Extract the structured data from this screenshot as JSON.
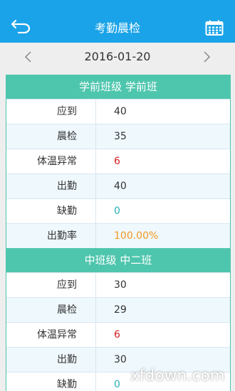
{
  "header": {
    "title": "考勤晨检",
    "back_icon": "back-arrow-icon",
    "calendar_icon": "calendar-icon"
  },
  "datebar": {
    "date": "2016-01-20",
    "prev_icon": "chevron-left-icon",
    "next_icon": "chevron-right-icon"
  },
  "cards": [
    {
      "title": "学前班级 学前班",
      "rows": [
        {
          "label": "应到",
          "value": "40"
        },
        {
          "label": "晨检",
          "value": "35"
        },
        {
          "label": "体温异常",
          "value": "6"
        },
        {
          "label": "出勤",
          "value": "40"
        },
        {
          "label": "缺勤",
          "value": "0"
        },
        {
          "label": "出勤率",
          "value": "100.00%"
        }
      ]
    },
    {
      "title": "中班级 中二班",
      "rows": [
        {
          "label": "应到",
          "value": "30"
        },
        {
          "label": "晨检",
          "value": "29"
        },
        {
          "label": "体温异常",
          "value": "6"
        },
        {
          "label": "出勤",
          "value": "30"
        },
        {
          "label": "缺勤",
          "value": "0"
        }
      ]
    }
  ],
  "colors": {
    "header": "#1aa3e8",
    "card_accent": "#4ec6ad",
    "abnormal": "#d32020",
    "absent": "#2ab0b8",
    "rate": "#f3971e"
  },
  "watermark": "xfdown.com"
}
